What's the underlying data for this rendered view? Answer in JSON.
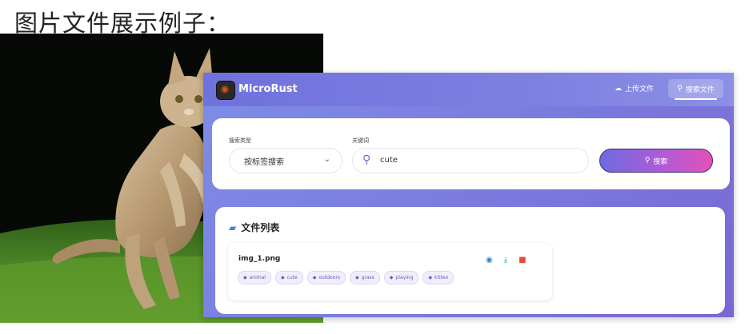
{
  "heading": "图片文件展示例子：",
  "app": {
    "brand": "MicroRust",
    "nav": {
      "upload_label": "上传文件",
      "search_label": "搜索文件"
    },
    "search": {
      "type_label": "搜索类型",
      "type_value": "按标签搜索",
      "keyword_label": "关键词",
      "keyword_value": "cute",
      "button_label": "搜索"
    },
    "file_list": {
      "title": "文件列表",
      "files": [
        {
          "name": "img_1.png",
          "tags": [
            "animal",
            "cute",
            "outdoors",
            "grass",
            "playing",
            "kitten"
          ]
        }
      ]
    }
  },
  "icons": [
    "logo-icon",
    "cloud-upload-icon",
    "search-icon",
    "chevron-down-icon",
    "folder-icon",
    "eye-icon",
    "download-icon",
    "trash-icon",
    "tag-icon"
  ],
  "colors": {
    "accent": "#6a63d8",
    "gradient_end": "#e152b5",
    "view": "#3b82c4",
    "download": "#27ae60",
    "delete": "#e74c3c"
  }
}
